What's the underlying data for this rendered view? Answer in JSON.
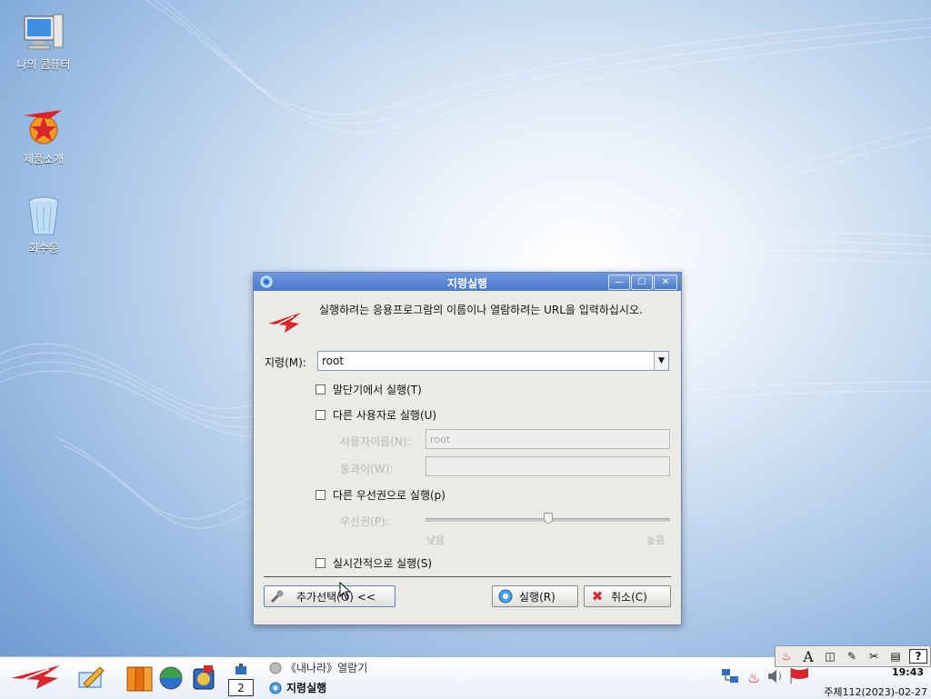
{
  "desktop": {
    "icons": [
      {
        "label": "나의 콤퓨터",
        "icon": "computer-icon"
      },
      {
        "label": "제품소개",
        "icon": "product-star-icon"
      },
      {
        "label": "회수통",
        "icon": "recycle-bin-icon"
      }
    ]
  },
  "dialog": {
    "title": "지령실행",
    "message": "실행하려는 응용프로그람의 이름이나 열람하려는 URL을 입력하십시오.",
    "command_label": "지령(M):",
    "command_value": "root",
    "options": {
      "run_in_terminal": "말단기에서 실행(T)",
      "run_as_other_user": "다른 사용자로 실행(U)",
      "username_label": "사용자이름(N):",
      "username_value": "root",
      "password_label": "통과어(W):",
      "run_with_priority": "다른 우선권으로 실행(p)",
      "priority_label": "우선권(P):",
      "priority_low": "낮음",
      "priority_high": "높음",
      "priority_level": 0.5,
      "run_realtime": "실시간적으로 실행(S)"
    },
    "buttons": {
      "more_options": "추가선택(O) <<",
      "run": "실행(R)",
      "cancel": "취소(C)"
    },
    "window_buttons": {
      "minimize": "—",
      "maximize": "☐",
      "close": "✕"
    }
  },
  "taskbar": {
    "tasks": [
      {
        "label": "《내나라》열람기",
        "icon": "browser-icon"
      },
      {
        "label": "지령실행",
        "icon": "run-command-icon"
      }
    ],
    "pager_value": "2",
    "tray_items": [
      "fire-icon",
      "font-icon",
      "panel-icon",
      "note-icon",
      "tools-icon",
      "clipboard-icon",
      "help-icon"
    ],
    "tray_glyphs": [
      "♨",
      "A",
      "◫",
      "✎",
      "✂",
      "▤",
      "?"
    ],
    "clock": "19:43",
    "date": "주체112(2023)-02-27"
  },
  "colors": {
    "titlebar": "#5583d3",
    "accent_red": "#d8262c"
  }
}
